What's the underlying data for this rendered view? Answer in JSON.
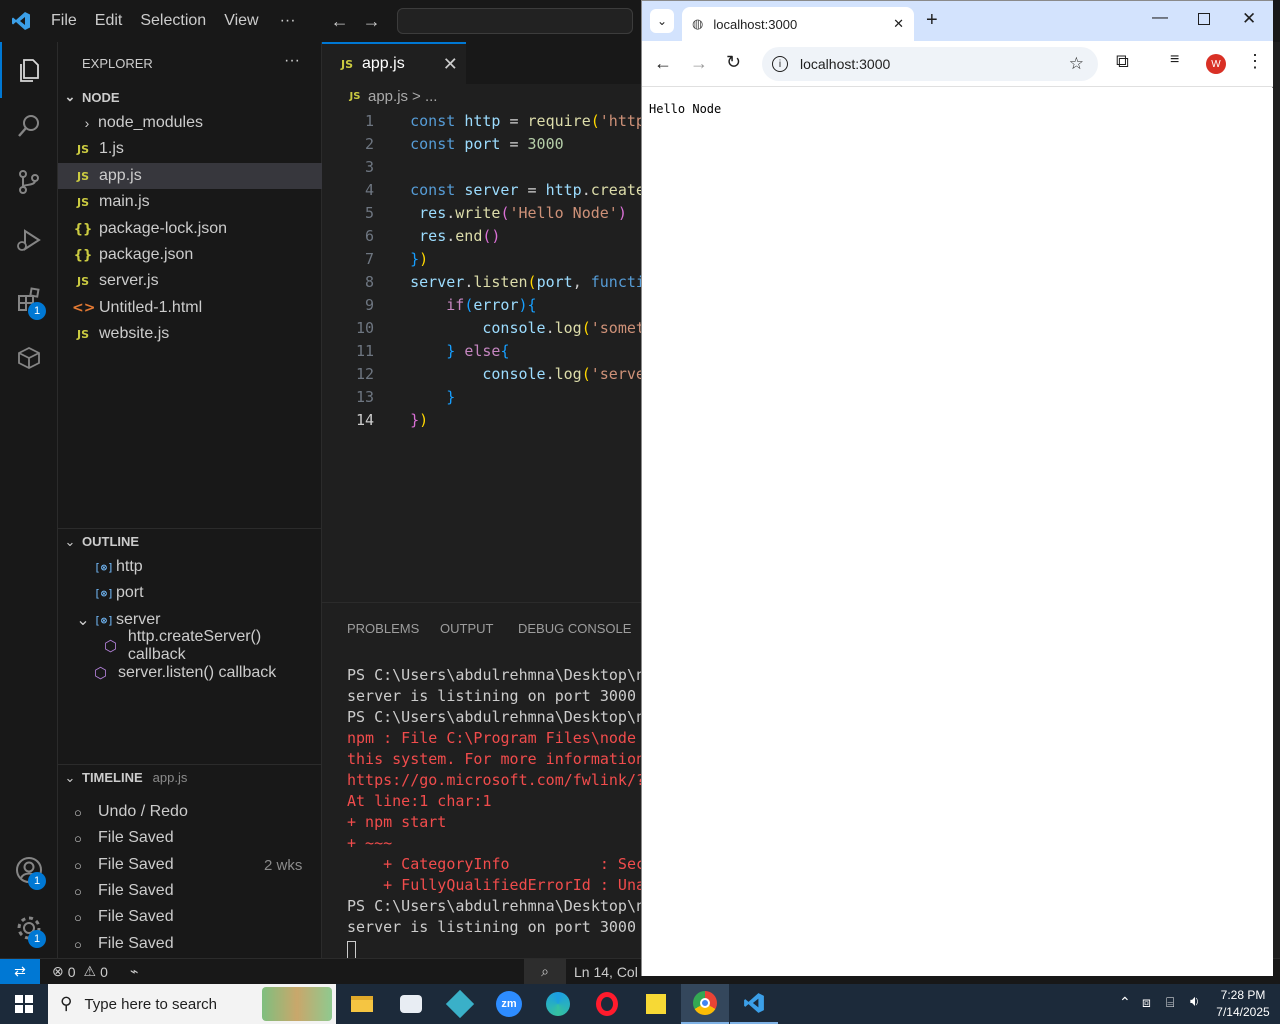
{
  "titlebar": {
    "menus": [
      "File",
      "Edit",
      "Selection",
      "View"
    ],
    "more": "···"
  },
  "activity": {
    "extensions_badge": "1",
    "accounts_badge": "1",
    "manage_badge": "1"
  },
  "explorer": {
    "title": "EXPLORER",
    "more": "···",
    "folder": "NODE",
    "items": [
      {
        "label": "node_modules",
        "type": "folder"
      },
      {
        "label": "1.js",
        "type": "js"
      },
      {
        "label": "app.js",
        "type": "js"
      },
      {
        "label": "main.js",
        "type": "js"
      },
      {
        "label": "package-lock.json",
        "type": "json"
      },
      {
        "label": "package.json",
        "type": "json"
      },
      {
        "label": "server.js",
        "type": "js"
      },
      {
        "label": "Untitled-1.html",
        "type": "html"
      },
      {
        "label": "website.js",
        "type": "js"
      }
    ]
  },
  "outline": {
    "title": "OUTLINE",
    "items": [
      "http",
      "port",
      "server",
      "http.createServer() callback",
      "server.listen() callback"
    ]
  },
  "timeline": {
    "title": "TIMELINE",
    "file": "app.js",
    "items": [
      "Undo / Redo",
      "File Saved",
      "File Saved",
      "File Saved",
      "File Saved",
      "File Saved"
    ],
    "age": "2 wks"
  },
  "editor": {
    "tab_label": "app.js",
    "tab_icon": "JS",
    "breadcrumb_file": "app.js",
    "breadcrumb_rest": "> ...",
    "current_line": "14"
  },
  "panel": {
    "tabs": [
      "PROBLEMS",
      "OUTPUT",
      "DEBUG CONSOLE"
    ],
    "lines": [
      {
        "text": "PS C:\\Users\\abdulrehmna\\Desktop\\n",
        "err": false
      },
      {
        "text": "server is listining on port 3000",
        "err": false
      },
      {
        "text": "PS C:\\Users\\abdulrehmna\\Desktop\\n",
        "err": false
      },
      {
        "text": "npm : File C:\\Program Files\\node",
        "err": true
      },
      {
        "text": "this system. For more information",
        "err": true
      },
      {
        "text": "https://go.microsoft.com/fwlink/?L",
        "err": true
      },
      {
        "text": "At line:1 char:1",
        "err": true
      },
      {
        "text": "+ npm start",
        "err": true
      },
      {
        "text": "+ ~~~",
        "err": true
      },
      {
        "text": "    + CategoryInfo          : Sec",
        "err": true
      },
      {
        "text": "    + FullyQualifiedErrorId : Una",
        "err": true
      },
      {
        "text": "PS C:\\Users\\abdulrehmna\\Desktop\\n",
        "err": false
      },
      {
        "text": "server is listining on port 3000",
        "err": false
      }
    ]
  },
  "statusbar": {
    "errors": "0",
    "warnings": "0",
    "position": "Ln 14, Col"
  },
  "browser": {
    "tab_title": "localhost:3000",
    "address": "localhost:3000",
    "profile_initial": "W",
    "page_text": "Hello Node"
  },
  "taskbar": {
    "search_placeholder": "Type here to search",
    "time": "7:28 PM",
    "date": "7/14/2025"
  }
}
